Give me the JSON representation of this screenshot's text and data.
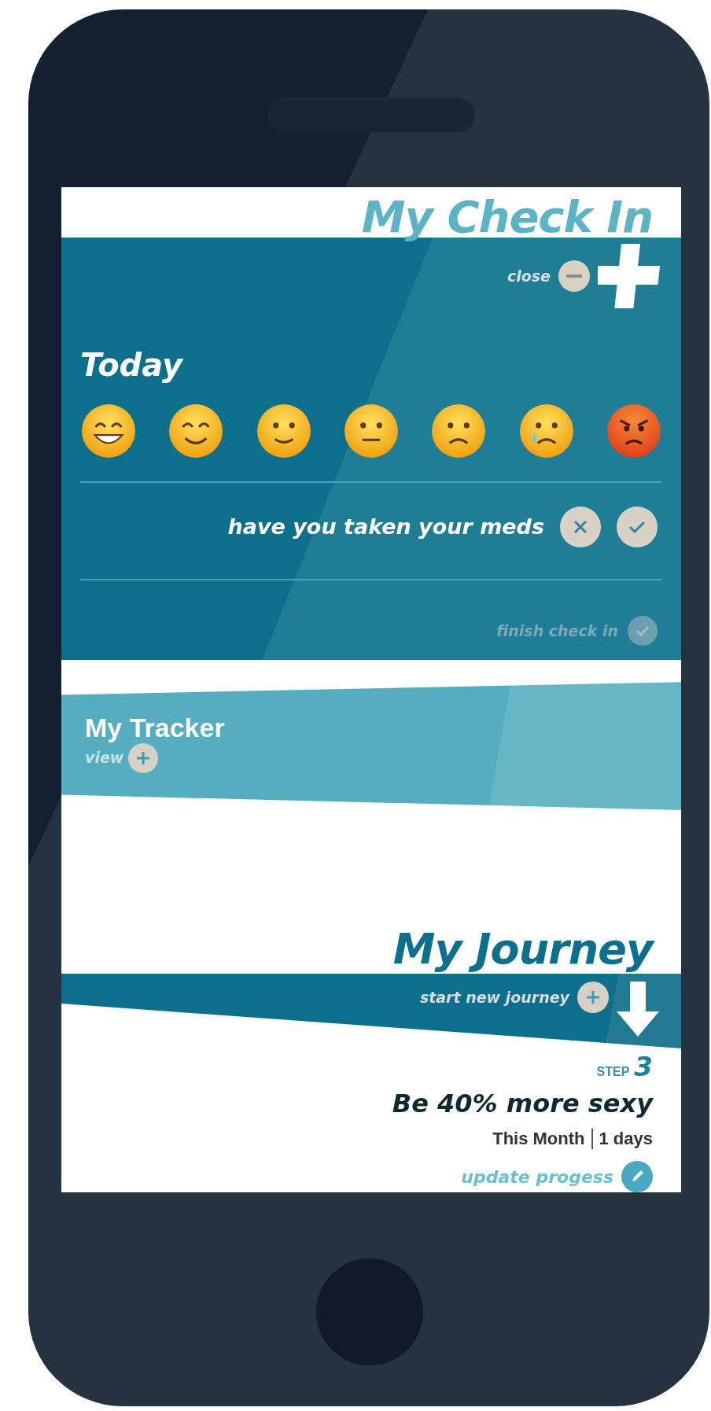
{
  "checkin": {
    "title": "My Check In",
    "close_label": "close",
    "today_label": "Today",
    "moods": [
      {
        "kind": "grin"
      },
      {
        "kind": "happy"
      },
      {
        "kind": "smile"
      },
      {
        "kind": "neutral"
      },
      {
        "kind": "worried"
      },
      {
        "kind": "crying"
      },
      {
        "kind": "angry"
      }
    ],
    "meds_question": "have you taken your meds",
    "finish_label": "finish check in",
    "finish_disabled": true
  },
  "tracker": {
    "title": "My Tracker",
    "view_label": "view"
  },
  "journey": {
    "title": "My Journey",
    "start_label": "start new journey",
    "step_label": "STEP",
    "step_number": "3",
    "goal": "Be 40% more sexy",
    "period": "This Month",
    "duration": "1 days",
    "update_label": "update progess"
  }
}
